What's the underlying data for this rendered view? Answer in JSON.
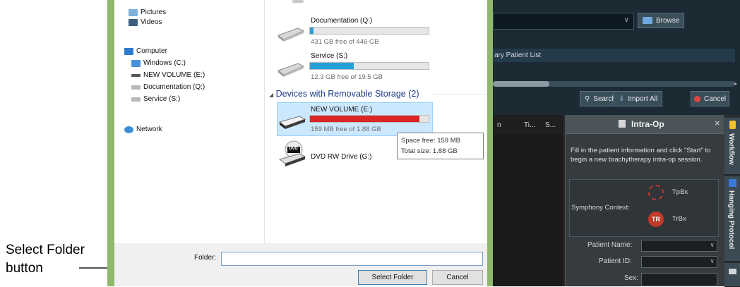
{
  "annotation": {
    "line1": "Select Folder",
    "line2": "button"
  },
  "dialog": {
    "nav": [
      {
        "label": "Pictures",
        "icon": "pictures-icon"
      },
      {
        "label": "Videos",
        "icon": "videos-icon"
      },
      {
        "label": "Computer",
        "icon": "computer-icon"
      },
      {
        "label": "Windows (C:)",
        "icon": "windows-drive-icon"
      },
      {
        "label": "NEW VOLUME (E:)",
        "icon": "drive-icon"
      },
      {
        "label": "Documentation (Q:)",
        "icon": "network-drive-icon"
      },
      {
        "label": "Service (S:)",
        "icon": "network-drive-icon"
      },
      {
        "label": "Network",
        "icon": "network-icon"
      }
    ],
    "drives": [
      {
        "title": "Documentation (Q:)",
        "free": "431 GB free of 446 GB",
        "used_fraction": 0.03,
        "color": "#26a0da"
      },
      {
        "title": "Service (S:)",
        "free": "12.3 GB free of 19.5 GB",
        "used_fraction": 0.37,
        "color": "#26a0da"
      },
      {
        "title": "NEW VOLUME (E:)",
        "free": "159 MB free of 1.88 GB",
        "used_fraction": 0.92,
        "color": "#da2626"
      }
    ],
    "group_removable": "Devices with Removable Storage (2)",
    "dvd_drive": "DVD RW Drive (G:)",
    "dvd_badge": "DVD",
    "tooltip": {
      "line1": "Space free: 159 MB",
      "line2": "Total size: 1.88 GB"
    },
    "folder_label": "Folder:",
    "folder_value": "",
    "select_folder_label": "Select Folder",
    "cancel_label": "Cancel"
  },
  "app": {
    "browse_label": "Browse",
    "list_label": "ary Patient List",
    "search_label": "Search",
    "import_all_label": "Import All",
    "cancel_label": "Cancel",
    "columns": [
      "n",
      "Ti...",
      "S..."
    ],
    "panel": {
      "title": "Intra-Op",
      "close": "×",
      "instructions": "Fill in the patient information and click \"Start\" to begin a new brachytherapy intra-op session.",
      "symphony_context": "Symphony Context:",
      "options": [
        {
          "label": "TpBx"
        },
        {
          "badge": "TR",
          "label": "TrBx"
        }
      ],
      "fields": [
        "Patient Name:",
        "Patient ID:",
        "Sex:"
      ]
    },
    "side_tabs": [
      "Workflow",
      "Hanging Protocol",
      ""
    ]
  }
}
